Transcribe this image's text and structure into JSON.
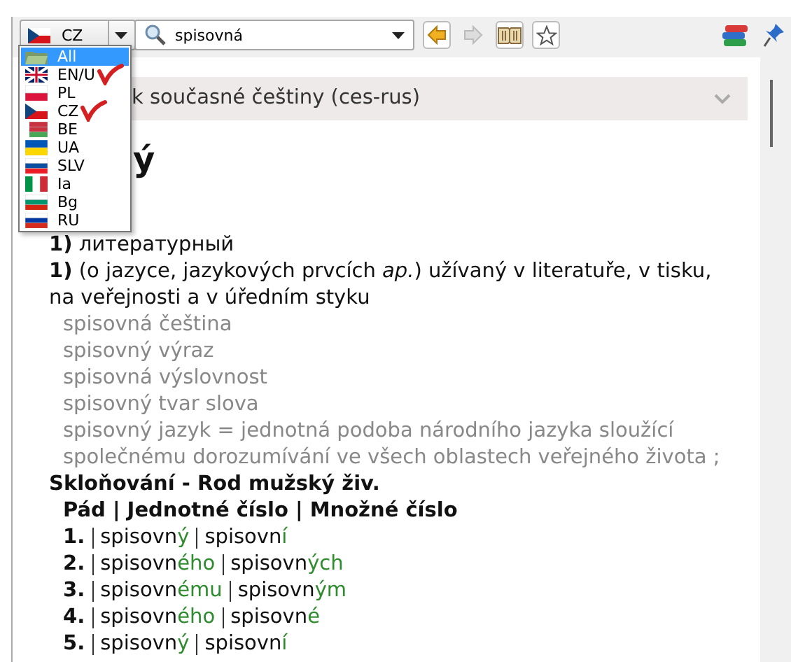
{
  "toolbar": {
    "language": "CZ",
    "search_value": "spisovná",
    "buttons": [
      {
        "kind": "back",
        "disabled": false
      },
      {
        "kind": "forward",
        "disabled": true
      },
      {
        "kind": "book",
        "disabled": false
      },
      {
        "kind": "star",
        "disabled": false
      }
    ]
  },
  "language_menu": [
    {
      "label": "All",
      "selected": true,
      "annotated": false
    },
    {
      "label": "EN/U",
      "selected": false,
      "annotated": true
    },
    {
      "label": "PL",
      "selected": false,
      "annotated": false
    },
    {
      "label": "CZ",
      "selected": false,
      "annotated": true
    },
    {
      "label": "BE",
      "selected": false,
      "annotated": false
    },
    {
      "label": "UA",
      "selected": false,
      "annotated": false
    },
    {
      "label": "SLV",
      "selected": false,
      "annotated": false
    },
    {
      "label": "Ia",
      "selected": false,
      "annotated": false
    },
    {
      "label": "Bg",
      "selected": false,
      "annotated": false
    },
    {
      "label": "RU",
      "selected": false,
      "annotated": false
    }
  ],
  "article": {
    "dictionary": "k současné češtiny (ces-rus)",
    "headword": "ý",
    "translation": "**1)** литературный",
    "definition": "**1)** (o jazyce, jazykových prvcích *ap.*) užívaný v literatuře, v tisku, na veřejnosti a v úředním styku",
    "examples": [
      "spisovná čeština",
      "spisovný výraz",
      "spisovná výslovnost",
      "spisovný tvar slova",
      "spisovný jazyk = jednotná podoba národního jazyka sloužící společnému dorozumívání ve všech oblastech veřejného života ;"
    ],
    "declension_title": "Skloňování - Rod mužský živ.",
    "declension_header": "Pád | Jednotné číslo | Množné číslo",
    "declension_rows": [
      {
        "case": "1.",
        "singular": [
          "spisovn",
          "ý"
        ],
        "plural": [
          "spisovn",
          "í"
        ]
      },
      {
        "case": "2.",
        "singular": [
          "spisovn",
          "ého"
        ],
        "plural": [
          "spisovn",
          "ých"
        ]
      },
      {
        "case": "3.",
        "singular": [
          "spisovn",
          "ému"
        ],
        "plural": [
          "spisovn",
          "ým"
        ]
      },
      {
        "case": "4.",
        "singular": [
          "spisovn",
          "ého"
        ],
        "plural": [
          "spisovn",
          "é"
        ]
      },
      {
        "case": "5.",
        "singular": [
          "spisovn",
          "ý"
        ],
        "plural": [
          "spisovn",
          "í"
        ]
      }
    ]
  }
}
